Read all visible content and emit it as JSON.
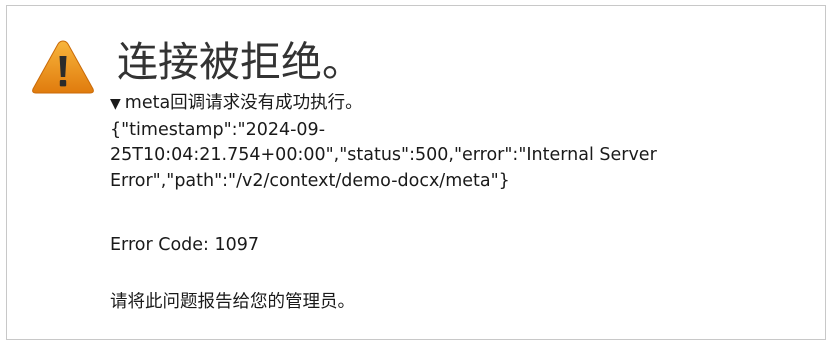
{
  "error_page": {
    "title": "连接被拒绝。",
    "details_summary": "meta回调请求没有成功执行。",
    "details_body_lines": [
      "{\"timestamp\":\"2024-09-",
      "25T10:04:21.754+00:00\",\"status\":500,\"error\":\"Internal Server",
      "Error\",\"path\":\"/v2/context/demo-docx/meta\"}"
    ],
    "error_code_text": "Error Code: 1097",
    "admin_note": "请将此问题报告给您的管理员。",
    "icon": "warning-icon",
    "colors": {
      "icon_top": "#f8b53c",
      "icon_bottom": "#e07b0d",
      "icon_mark": "#2b2b2b",
      "border": "#c8c8c8",
      "title": "#333333"
    }
  }
}
